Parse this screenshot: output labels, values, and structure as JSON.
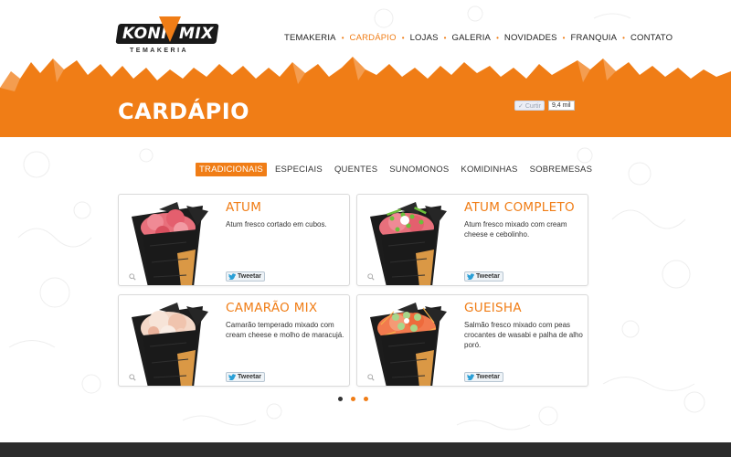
{
  "logo": {
    "word1": "KONI",
    "word2": "MIX",
    "subtitle": "TEMAKERIA"
  },
  "nav": {
    "items": [
      {
        "label": "TEMAKERIA",
        "active": false
      },
      {
        "label": "CARDÁPIO",
        "active": true
      },
      {
        "label": "LOJAS",
        "active": false
      },
      {
        "label": "GALERIA",
        "active": false
      },
      {
        "label": "NOVIDADES",
        "active": false
      },
      {
        "label": "FRANQUIA",
        "active": false
      },
      {
        "label": "CONTATO",
        "active": false
      }
    ],
    "separator": "•"
  },
  "banner": {
    "title": "CARDÁPIO"
  },
  "social": {
    "like_label": "Curtir",
    "like_count": "9,4 mil",
    "tweet_label": "Tweetar"
  },
  "tabs": [
    {
      "label": "TRADICIONAIS",
      "active": true
    },
    {
      "label": "ESPECIAIS",
      "active": false
    },
    {
      "label": "QUENTES",
      "active": false
    },
    {
      "label": "SUNOMONOS",
      "active": false
    },
    {
      "label": "KOMIDINHAS",
      "active": false
    },
    {
      "label": "SOBREMESAS",
      "active": false
    }
  ],
  "products": [
    {
      "name": "ATUM",
      "description": "Atum fresco cortado em cubos.",
      "filling": "tuna"
    },
    {
      "name": "ATUM COMPLETO",
      "description": "Atum fresco mixado com cream cheese e cebolinho.",
      "filling": "tuna-complete"
    },
    {
      "name": "CAMARÃO MIX",
      "description": "Camarão temperado mixado com cream cheese e molho de maracujá.",
      "filling": "shrimp"
    },
    {
      "name": "GUEISHA",
      "description": "Salmão fresco mixado com peas crocantes de wasabi e palha de alho poró.",
      "filling": "salmon"
    }
  ],
  "pager": {
    "total": 3,
    "current": 1
  },
  "colors": {
    "accent": "#f07d16",
    "dark": "#2c2c2c",
    "nori": "#1c1c1c"
  }
}
